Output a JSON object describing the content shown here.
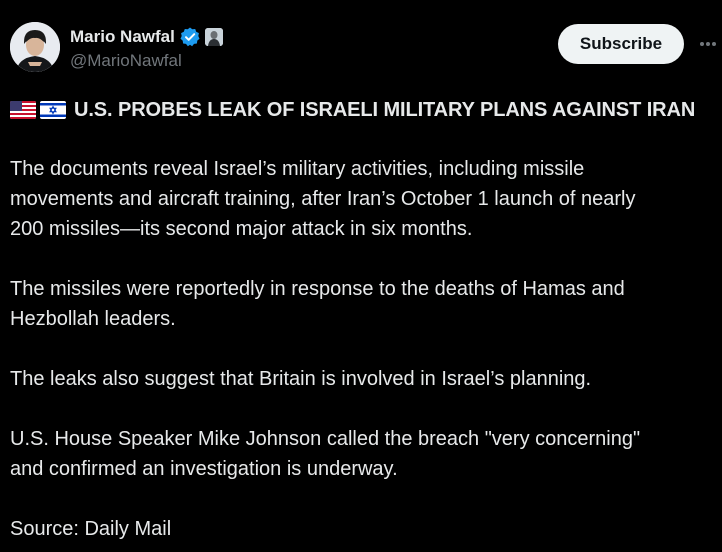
{
  "author": {
    "name": "Mario Nawfal",
    "handle": "@MarioNawfal",
    "avatar_icon": "person-avatar",
    "verified_icon": "verified-badge-icon",
    "affiliation_icon": "affiliate-badge-icon"
  },
  "actions": {
    "subscribe_label": "Subscribe",
    "more_icon": "more-options-icon"
  },
  "post": {
    "flags": [
      "us-flag-icon",
      "israel-flag-icon"
    ],
    "headline": "U.S. PROBES LEAK OF ISRAELI MILITARY PLANS AGAINST IRAN",
    "paragraphs": [
      "The documents reveal Israel’s military activities, including missile\nmovements and aircraft training, after Iran’s October 1 launch of nearly\n200 missiles—its second major attack in six months.",
      "The missiles were reportedly in response to the deaths of Hamas and\nHezbollah leaders.",
      "The leaks also suggest that Britain is involved in Israel’s planning.",
      "U.S. House Speaker Mike Johnson called the breach \"very concerning\"\nand confirmed an investigation is underway.",
      "Source: Daily Mail"
    ]
  },
  "colors": {
    "background": "#000000",
    "text": "#e7e9ea",
    "secondary_text": "#71767b",
    "verified": "#1d9bf0",
    "subscribe_bg": "#eff3f4"
  }
}
